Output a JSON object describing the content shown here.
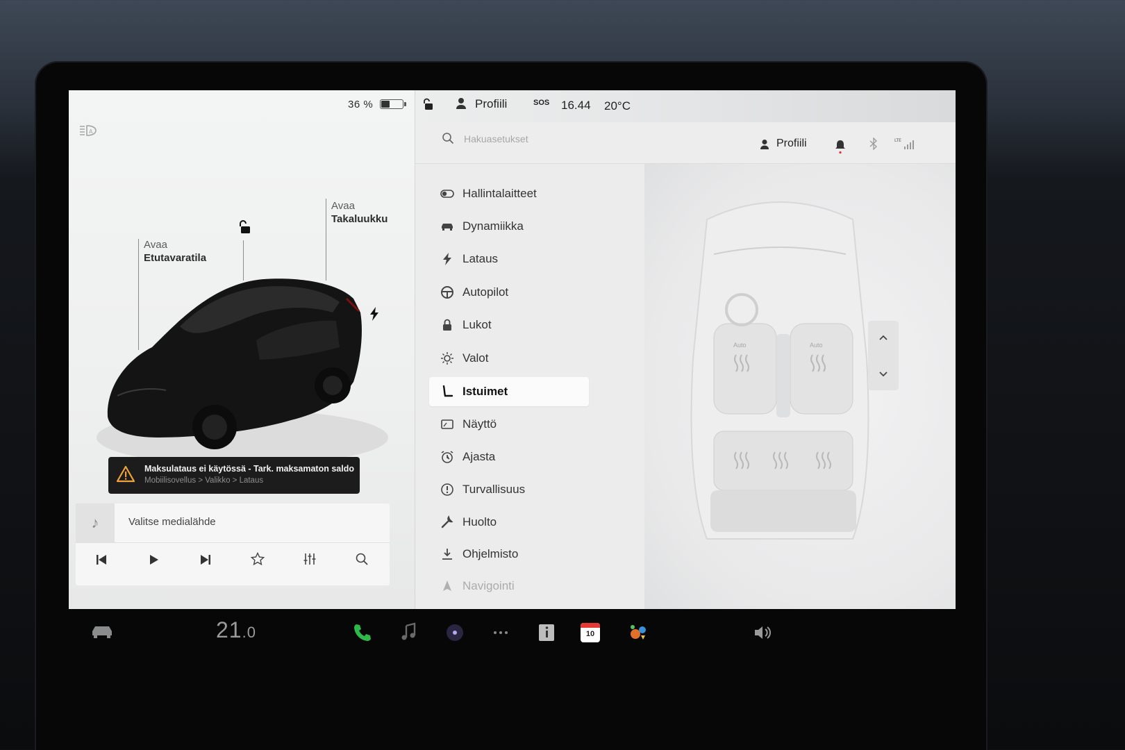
{
  "status": {
    "battery_percent": "36 %",
    "battery_level": 0.36,
    "profile": "Profiili",
    "sos": "SOS",
    "time": "16.44",
    "outside_temp": "20°C"
  },
  "car_view": {
    "frunk_label_top": "Avaa",
    "frunk_label_main": "Etutavaratila",
    "trunk_label_top": "Avaa",
    "trunk_label_main": "Takaluukku"
  },
  "alert": {
    "title": "Maksulataus ei käytössä - Tark. maksamaton saldo",
    "path": "Mobiilisovellus > Valikko > Lataus"
  },
  "media": {
    "source_prompt": "Valitse medialähde"
  },
  "search": {
    "placeholder": "Hakuasetukset",
    "profile": "Profiili"
  },
  "menu": {
    "items": [
      {
        "label": "Hallintalaitteet",
        "icon": "toggle-icon"
      },
      {
        "label": "Dynamiikka",
        "icon": "car-icon"
      },
      {
        "label": "Lataus",
        "icon": "bolt-icon"
      },
      {
        "label": "Autopilot",
        "icon": "steering-wheel-icon"
      },
      {
        "label": "Lukot",
        "icon": "lock-icon"
      },
      {
        "label": "Valot",
        "icon": "light-icon"
      },
      {
        "label": "Istuimet",
        "icon": "seat-icon",
        "active": true
      },
      {
        "label": "Näyttö",
        "icon": "display-icon"
      },
      {
        "label": "Ajasta",
        "icon": "alarm-clock-icon"
      },
      {
        "label": "Turvallisuus",
        "icon": "info-circle-icon"
      },
      {
        "label": "Huolto",
        "icon": "wrench-icon"
      },
      {
        "label": "Ohjelmisto",
        "icon": "download-icon"
      },
      {
        "label": "Navigointi",
        "icon": "navigation-icon"
      }
    ]
  },
  "seats": {
    "front_left_heat": "Auto",
    "front_right_heat": "Auto"
  },
  "dock": {
    "cabin_temp": "21",
    "cabin_temp_decimal": ".0",
    "calendar_day": "10"
  },
  "colors": {
    "phone_green": "#2fb84a",
    "alert_bg": "#1c1c1c",
    "calendar_red": "#e53935"
  }
}
